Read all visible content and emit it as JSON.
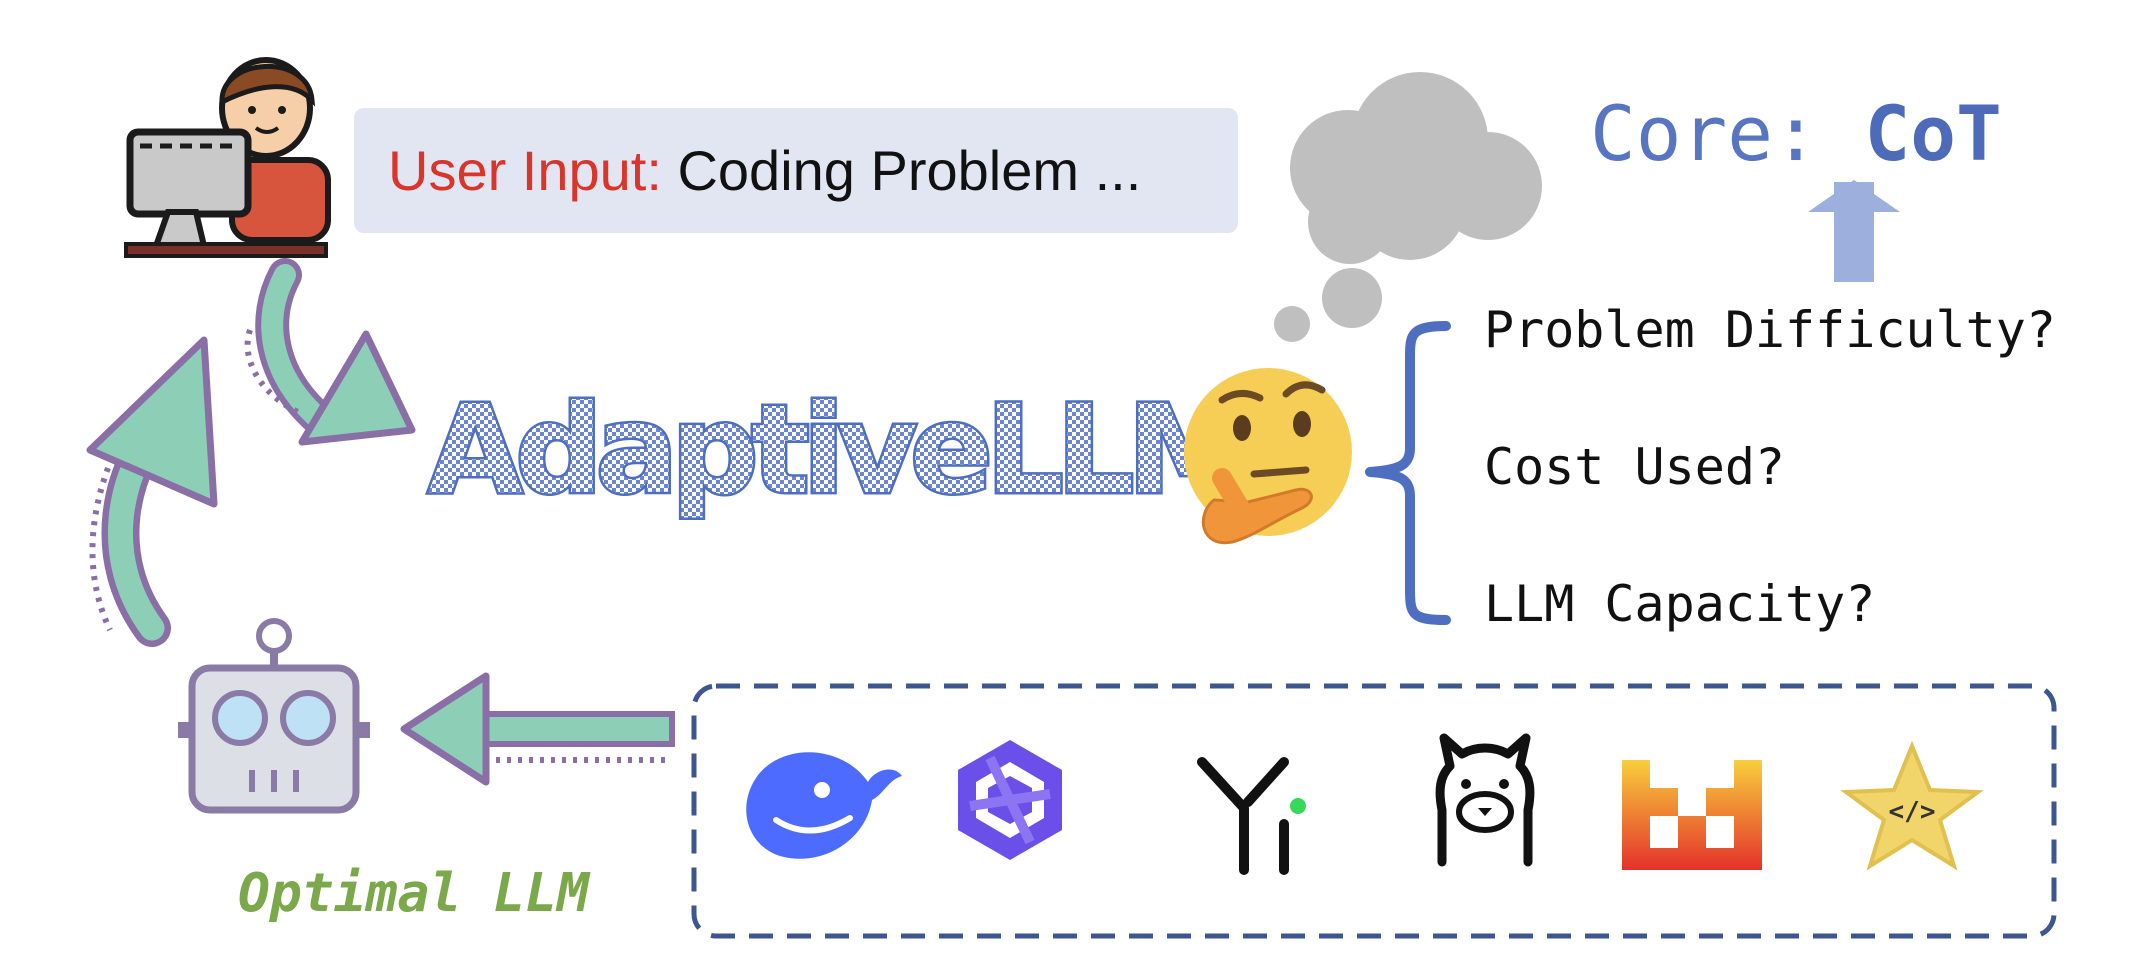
{
  "user_input": {
    "label": "User Input:",
    "text": "Coding Problem ..."
  },
  "core": {
    "prefix": "Core:",
    "value": "CoT"
  },
  "system_name": "AdaptiveLLM",
  "questions": [
    "Problem Difficulty?",
    "Cost Used?",
    "LLM Capacity?"
  ],
  "output_label": "Optimal LLM",
  "pool_icons": [
    "whale-logo-icon",
    "hexagon-star-logo-icon",
    "yi-logo-icon",
    "llama-logo-icon",
    "pixel-m-logo-icon",
    "code-star-icon"
  ],
  "colors": {
    "accent_blue": "#4e6ec0",
    "arrow_green": "#8ccfb6",
    "arrow_outline": "#8a6fa6",
    "input_label_red": "#d9352b",
    "optimal_green": "#7aa84a",
    "input_box_bg": "#e2e6f2",
    "dashed_border": "#3d568f"
  }
}
